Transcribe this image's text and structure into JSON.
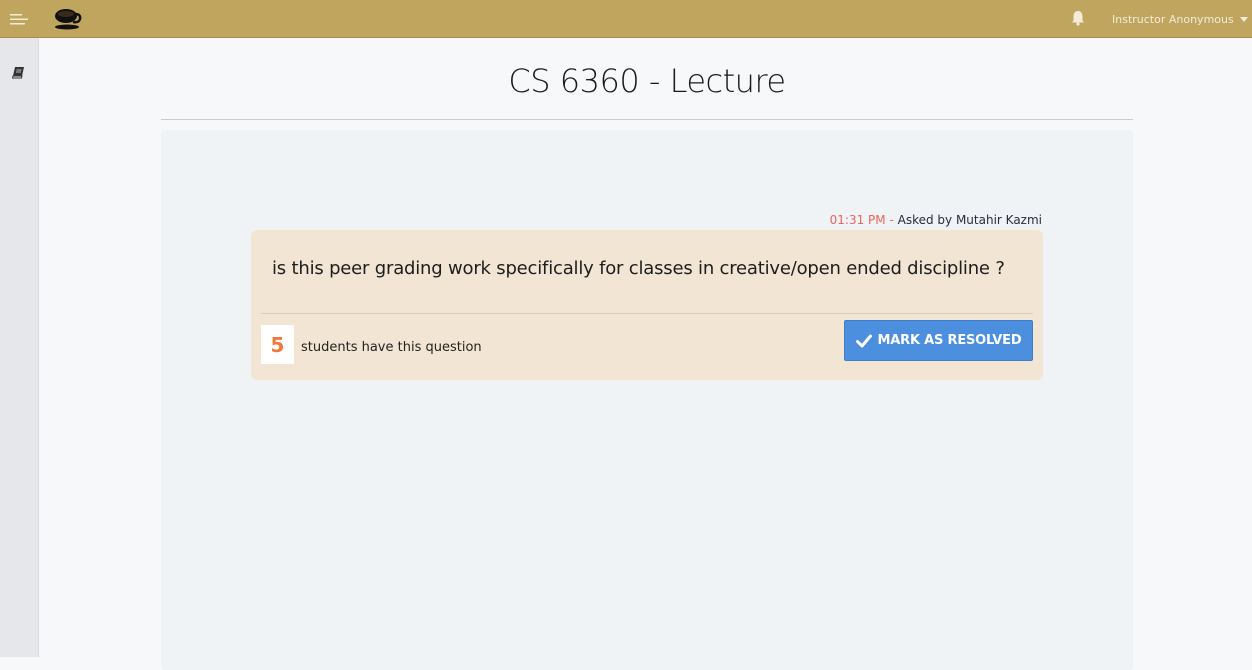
{
  "header": {
    "user_name": "Instructor Anonymous"
  },
  "page": {
    "title": "CS 6360 - Lecture"
  },
  "question": {
    "time": "01:31 PM",
    "separator": " - ",
    "asked_by": "Asked by Mutahir Kazmi",
    "text": "is this peer grading work specifically for classes in creative/open ended discipline ?",
    "count": "5",
    "count_label": "students have this question",
    "resolve_label": "MARK AS RESOLVED"
  },
  "colors": {
    "topbar": "#bfa55e",
    "card": "#f2e5d3",
    "button": "#4b8fde",
    "count": "#ef7a3c",
    "time": "#e8665a"
  },
  "icons": [
    "hamburger-icon",
    "coffee-cup-logo-icon",
    "bell-icon",
    "caret-down-icon",
    "book-icon",
    "checkmark-icon"
  ]
}
